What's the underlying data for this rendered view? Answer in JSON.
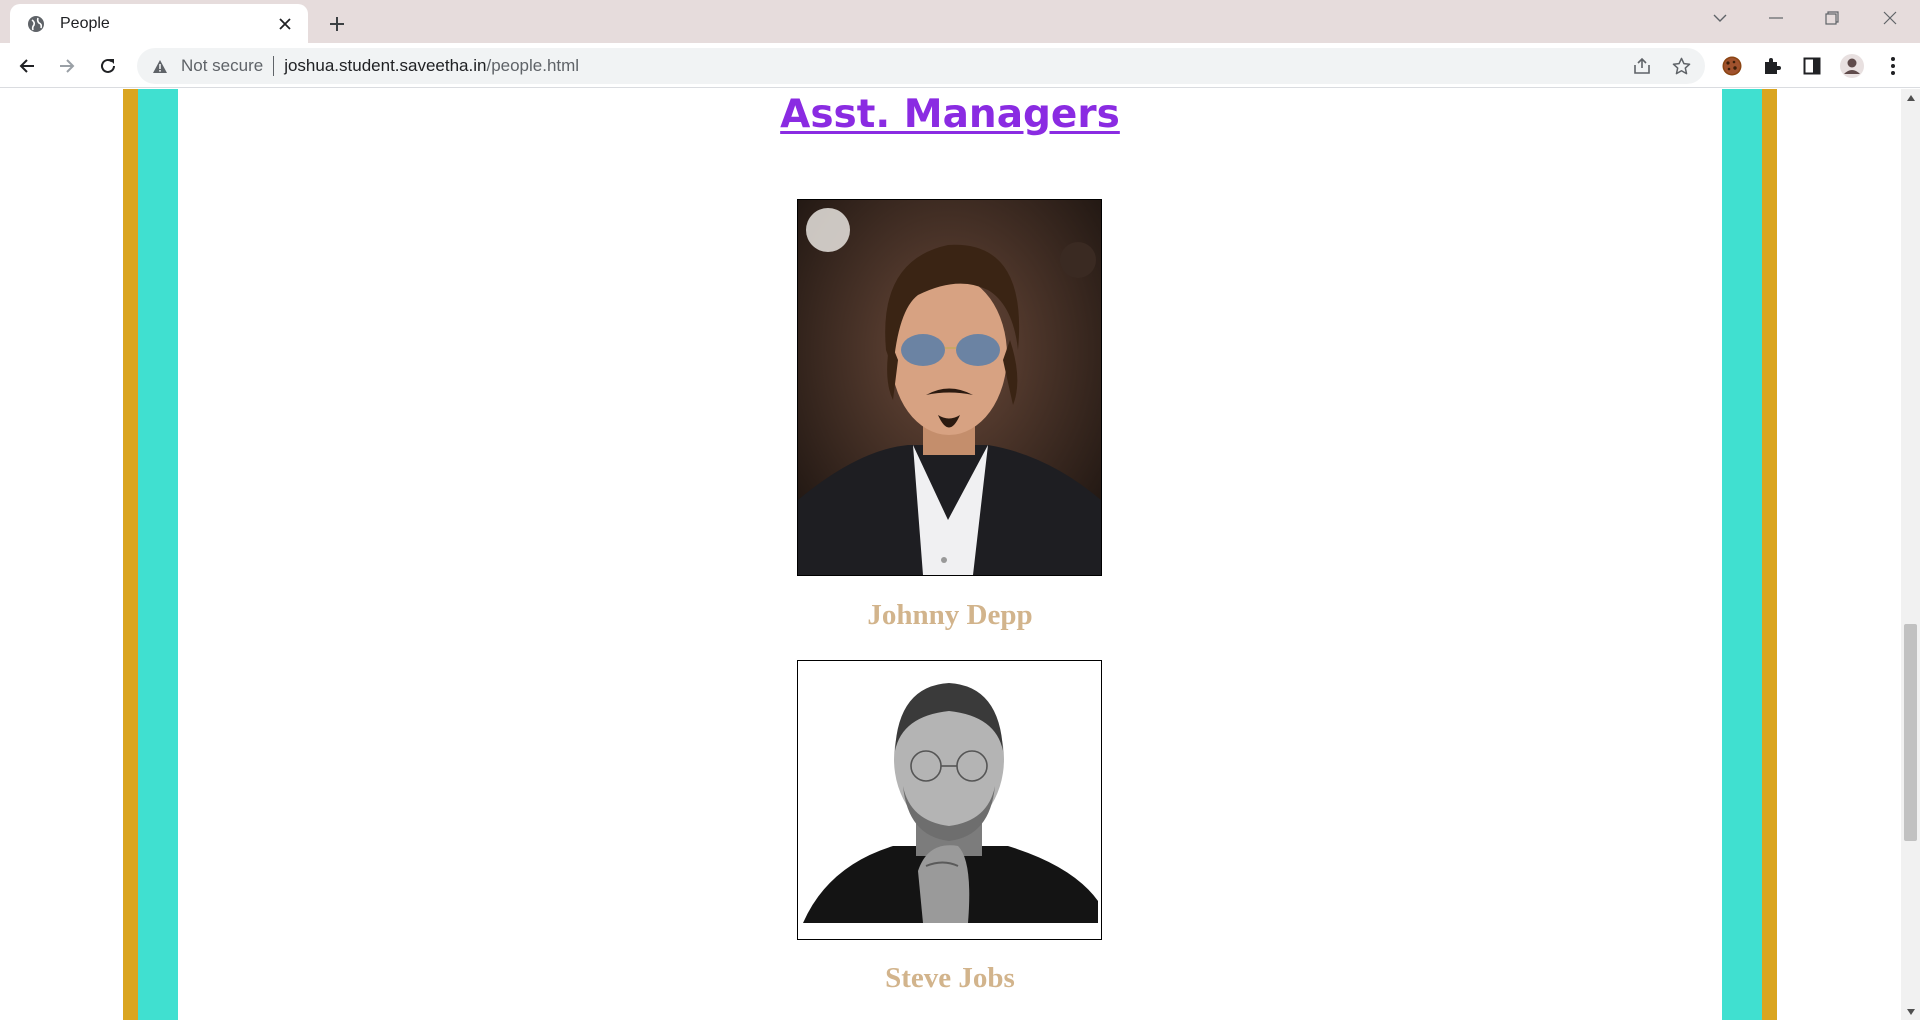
{
  "browser": {
    "tab": {
      "title": "People",
      "favicon": "globe-icon"
    },
    "address": {
      "security_label": "Not secure",
      "host": "joshua.student.saveetha.in",
      "path": "/people.html"
    },
    "icons": [
      "back-icon",
      "forward-icon",
      "reload-icon",
      "share-icon",
      "bookmark-star-icon",
      "cookie-extension-icon",
      "puzzle-extensions-icon",
      "side-panel-icon",
      "profile-avatar-icon",
      "kebab-menu-icon"
    ],
    "colors": {
      "tabbar": "#e6dcdc",
      "omnibox": "#f1f3f4"
    }
  },
  "page": {
    "heading": "Asst. Managers",
    "people": [
      {
        "name": "Johnny Depp",
        "photo": "portrait-photo"
      },
      {
        "name": "Steve Jobs",
        "photo": "portrait-photo-bw"
      }
    ],
    "colors": {
      "gold_stripe": "#daa520",
      "teal_stripe": "#40e0d0",
      "heading": "#8a2be2",
      "caption": "#d2b48c"
    }
  }
}
